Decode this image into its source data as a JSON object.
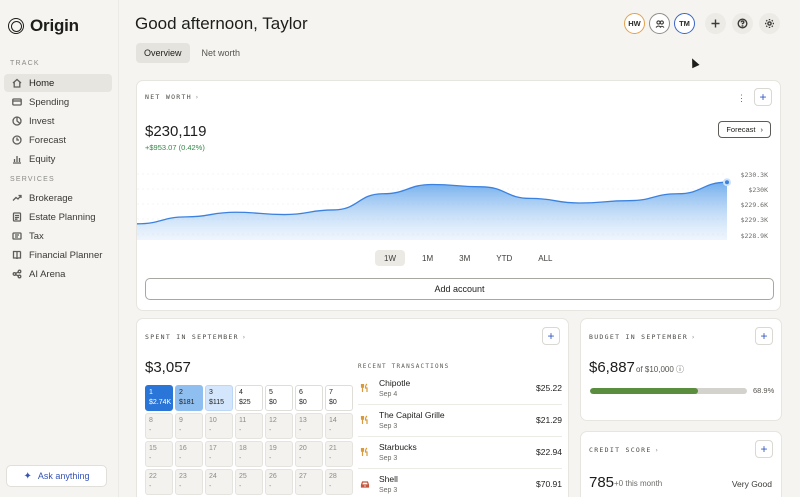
{
  "app": {
    "name": "Origin"
  },
  "sidebar": {
    "sections": [
      {
        "label": "TRACK",
        "items": [
          {
            "label": "Home",
            "icon": "home-icon",
            "active": true
          },
          {
            "label": "Spending",
            "icon": "card-icon"
          },
          {
            "label": "Invest",
            "icon": "pie-icon"
          },
          {
            "label": "Forecast",
            "icon": "clock-icon"
          },
          {
            "label": "Equity",
            "icon": "bar-chart-icon"
          }
        ]
      },
      {
        "label": "SERVICES",
        "items": [
          {
            "label": "Brokerage",
            "icon": "trend-icon"
          },
          {
            "label": "Estate Planning",
            "icon": "document-icon"
          },
          {
            "label": "Tax",
            "icon": "receipt-icon"
          },
          {
            "label": "Financial Planner",
            "icon": "book-icon"
          },
          {
            "label": "AI Arena",
            "icon": "nodes-icon"
          }
        ]
      }
    ],
    "ask_label": "Ask anything"
  },
  "header": {
    "greeting": "Good afternoon, Taylor",
    "tabs": [
      {
        "label": "Overview",
        "active": true
      },
      {
        "label": "Net worth"
      }
    ],
    "avatars": [
      {
        "initials": "HW",
        "color": "#e2a24b"
      },
      {
        "initials": "",
        "color": "#8e8d88"
      },
      {
        "initials": "TM",
        "color": "#3965c9"
      }
    ]
  },
  "net_worth": {
    "title": "NET WORTH",
    "value": "$230,119",
    "change": "+$953.07 (0.42%)",
    "forecast_label": "Forecast",
    "y_ticks": [
      "$230.3K",
      "$230K",
      "$229.6K",
      "$229.3K",
      "$228.9K"
    ],
    "ranges": [
      {
        "label": "1W",
        "active": true
      },
      {
        "label": "1M"
      },
      {
        "label": "3M"
      },
      {
        "label": "YTD"
      },
      {
        "label": "ALL"
      }
    ],
    "add_account_label": "Add account",
    "accent": "#3b82e0"
  },
  "chart_data": {
    "type": "area",
    "ylim": [
      228.8,
      230.4
    ],
    "values": [
      229.15,
      229.3,
      229.4,
      229.35,
      229.45,
      229.8,
      230.0,
      229.95,
      229.7,
      229.6,
      229.65,
      229.8,
      230.05
    ]
  },
  "spending": {
    "title": "SPENT IN SEPTEMBER",
    "total": "$3,057",
    "days": [
      {
        "day": "1",
        "amount": "$2.74K",
        "level": "d1"
      },
      {
        "day": "2",
        "amount": "$181",
        "level": "d2"
      },
      {
        "day": "3",
        "amount": "$115",
        "level": "d3"
      },
      {
        "day": "4",
        "amount": "$25",
        "level": ""
      },
      {
        "day": "5",
        "amount": "$0",
        "level": ""
      },
      {
        "day": "6",
        "amount": "$0",
        "level": ""
      },
      {
        "day": "7",
        "amount": "$0",
        "level": ""
      },
      {
        "day": "8",
        "amount": "-",
        "level": "future"
      },
      {
        "day": "9",
        "amount": "-",
        "level": "future"
      },
      {
        "day": "10",
        "amount": "-",
        "level": "future"
      },
      {
        "day": "11",
        "amount": "-",
        "level": "future"
      },
      {
        "day": "12",
        "amount": "-",
        "level": "future"
      },
      {
        "day": "13",
        "amount": "-",
        "level": "future"
      },
      {
        "day": "14",
        "amount": "-",
        "level": "future"
      },
      {
        "day": "15",
        "amount": "-",
        "level": "future"
      },
      {
        "day": "16",
        "amount": "-",
        "level": "future"
      },
      {
        "day": "17",
        "amount": "-",
        "level": "future"
      },
      {
        "day": "18",
        "amount": "-",
        "level": "future"
      },
      {
        "day": "19",
        "amount": "-",
        "level": "future"
      },
      {
        "day": "20",
        "amount": "-",
        "level": "future"
      },
      {
        "day": "21",
        "amount": "-",
        "level": "future"
      },
      {
        "day": "22",
        "amount": "-",
        "level": "future"
      },
      {
        "day": "23",
        "amount": "-",
        "level": "future"
      },
      {
        "day": "24",
        "amount": "-",
        "level": "future"
      },
      {
        "day": "25",
        "amount": "-",
        "level": "future"
      },
      {
        "day": "26",
        "amount": "-",
        "level": "future"
      },
      {
        "day": "27",
        "amount": "-",
        "level": "future"
      },
      {
        "day": "28",
        "amount": "-",
        "level": "future"
      }
    ],
    "recent_title": "RECENT TRANSACTIONS",
    "transactions": [
      {
        "name": "Chipotle",
        "date": "Sep 4",
        "amount": "$25.22",
        "icon": "utensils-icon"
      },
      {
        "name": "The Capital Grille",
        "date": "Sep 3",
        "amount": "$21.29",
        "icon": "utensils-icon"
      },
      {
        "name": "Starbucks",
        "date": "Sep 3",
        "amount": "$22.94",
        "icon": "utensils-icon"
      },
      {
        "name": "Shell",
        "date": "Sep 3",
        "amount": "$70.91",
        "icon": "car-icon"
      }
    ]
  },
  "budget": {
    "title": "BUDGET IN SEPTEMBER",
    "value": "$6,887",
    "of": "of $10,000",
    "progress": 0.689,
    "pct": "68.9%"
  },
  "credit": {
    "title": "CREDIT SCORE",
    "score": "785",
    "change": "+0 this month",
    "rating": "Very Good"
  }
}
